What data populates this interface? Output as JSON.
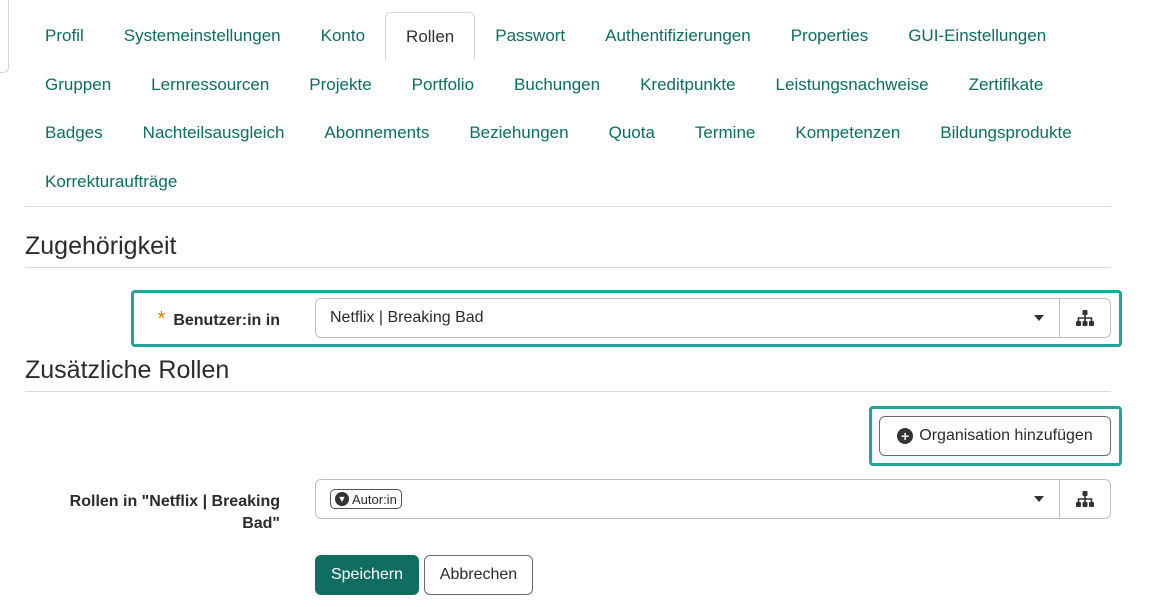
{
  "tabs": {
    "row1": [
      "Profil",
      "Systemeinstellungen",
      "Konto",
      "Rollen",
      "Passwort",
      "Authentifizierungen",
      "Properties",
      "GUI-Einstellungen"
    ],
    "row2": [
      "Gruppen",
      "Lernressourcen",
      "Projekte",
      "Portfolio",
      "Buchungen",
      "Kreditpunkte",
      "Leistungsnachweise",
      "Zertifikate"
    ],
    "row3": [
      "Badges",
      "Nachteilsausgleich",
      "Abonnements",
      "Beziehungen",
      "Quota",
      "Termine",
      "Kompetenzen",
      "Bildungsprodukte"
    ],
    "row4": [
      "Korrekturaufträge"
    ],
    "active": "Rollen"
  },
  "section1": {
    "title": "Zugehörigkeit",
    "required_marker": "*",
    "user_in_label": "Benutzer:in in",
    "user_in_value": "Netflix | Breaking Bad",
    "tree_icon": "org-tree-icon"
  },
  "section2": {
    "title": "Zusätzliche Rollen",
    "add_org_label": "Organisation hinzufügen",
    "add_icon": "plus-circle-icon",
    "roles_label_line1": "Rollen in \"Netflix | Breaking",
    "roles_label_line2": "Bad\"",
    "role_chip": "Autor:in",
    "role_chip_icon": "arrow-down-circle-icon",
    "tree_icon": "org-tree-icon"
  },
  "actions": {
    "save": "Speichern",
    "cancel": "Abbrechen"
  },
  "colors": {
    "accent": "#0b6e63",
    "highlight": "#21a59b",
    "primary_button": "#0f6d62",
    "required": "#e07b00"
  }
}
